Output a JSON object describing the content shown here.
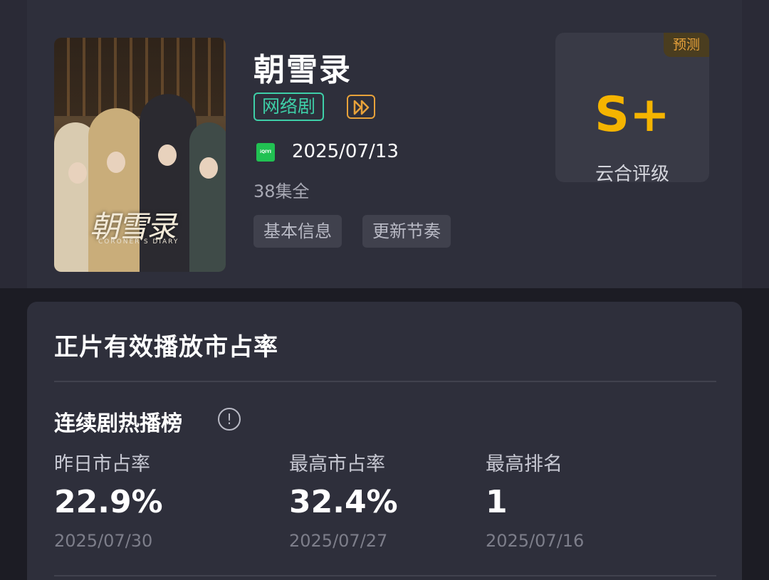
{
  "show": {
    "title": "朝雪录",
    "tag_type": "网络剧",
    "platform_logo_text": "iQIYI",
    "platform_icon": "iqiyi-logo",
    "release_date": "2025/07/13",
    "episodes": "38集全",
    "buttons": [
      "基本信息",
      "更新节奏"
    ],
    "poster": {
      "title_art": "朝雪录",
      "subtitle_art": "CORONER'S DIARY"
    }
  },
  "rating": {
    "badge": "预测",
    "grade": "S+",
    "label": "云合评级"
  },
  "market_share": {
    "section_title": "正片有效播放市占率",
    "list_title": "连续剧热播榜",
    "info_icon": "info-icon",
    "stats": [
      {
        "label": "昨日市占率",
        "value": "22.9%",
        "date": "2025/07/30"
      },
      {
        "label": "最高市占率",
        "value": "32.4%",
        "date": "2025/07/27"
      },
      {
        "label": "最高排名",
        "value": "1",
        "date": "2025/07/16"
      }
    ]
  },
  "colors": {
    "accent_green": "#3ecfa8",
    "accent_gold": "#f5b400",
    "play_orange": "#e8a23a",
    "card_bg": "#2e2f3b"
  }
}
